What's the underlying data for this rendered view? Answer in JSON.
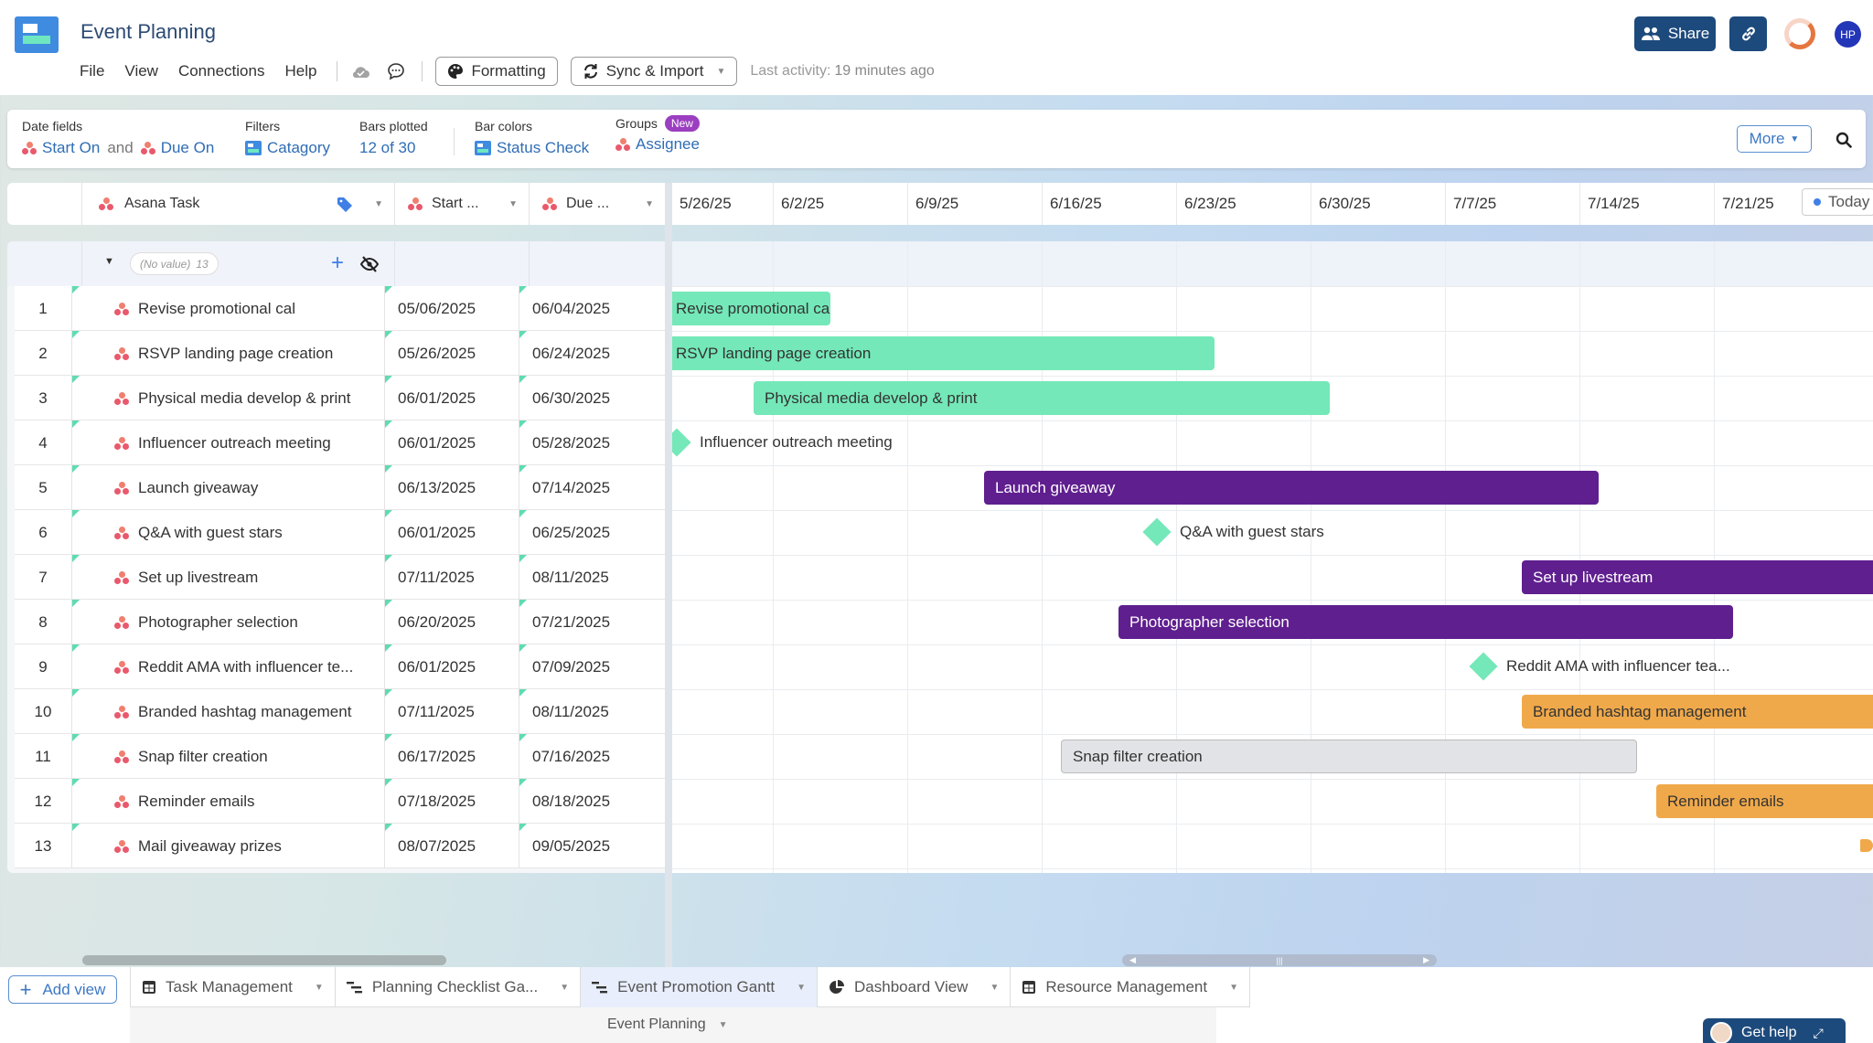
{
  "app": {
    "title": "Event Planning",
    "menu": [
      "File",
      "View",
      "Connections",
      "Help"
    ],
    "formatting_label": "Formatting",
    "sync_label": "Sync & Import",
    "last_activity_label": "Last activity:",
    "last_activity_value": "19 minutes ago",
    "share_label": "Share",
    "avatar_initials": "HP"
  },
  "settings": {
    "date_fields_label": "Date fields",
    "start_field": "Start On",
    "and_text": "and",
    "due_field": "Due On",
    "filters_label": "Filters",
    "filters_value": "Catagory",
    "bars_plotted_label": "Bars plotted",
    "bars_plotted_value": "12 of 30",
    "bar_colors_label": "Bar colors",
    "bar_colors_value": "Status Check",
    "groups_label": "Groups",
    "groups_badge": "New",
    "groups_value": "Assignee",
    "more_label": "More"
  },
  "grid": {
    "columns": {
      "task": "Asana Task",
      "start": "Start ...",
      "due": "Due ..."
    },
    "group": {
      "label": "(No value)",
      "count": "13"
    },
    "rows": [
      {
        "num": "1",
        "task": "Revise promotional cal",
        "start": "05/06/2025",
        "due": "06/04/2025"
      },
      {
        "num": "2",
        "task": "RSVP landing page creation",
        "start": "05/26/2025",
        "due": "06/24/2025"
      },
      {
        "num": "3",
        "task": "Physical media develop & print",
        "start": "06/01/2025",
        "due": "06/30/2025"
      },
      {
        "num": "4",
        "task": "Influencer outreach meeting",
        "start": "06/01/2025",
        "due": "05/28/2025"
      },
      {
        "num": "5",
        "task": "Launch giveaway",
        "start": "06/13/2025",
        "due": "07/14/2025"
      },
      {
        "num": "6",
        "task": "Q&A with guest stars",
        "start": "06/01/2025",
        "due": "06/25/2025"
      },
      {
        "num": "7",
        "task": "Set up livestream",
        "start": "07/11/2025",
        "due": "08/11/2025"
      },
      {
        "num": "8",
        "task": "Photographer selection",
        "start": "06/20/2025",
        "due": "07/21/2025"
      },
      {
        "num": "9",
        "task": "Reddit AMA with influencer te...",
        "start": "06/01/2025",
        "due": "07/09/2025"
      },
      {
        "num": "10",
        "task": "Branded hashtag management",
        "start": "07/11/2025",
        "due": "08/11/2025"
      },
      {
        "num": "11",
        "task": "Snap filter creation",
        "start": "06/17/2025",
        "due": "07/16/2025"
      },
      {
        "num": "12",
        "task": "Reminder emails",
        "start": "07/18/2025",
        "due": "08/18/2025"
      },
      {
        "num": "13",
        "task": "Mail giveaway prizes",
        "start": "08/07/2025",
        "due": "09/05/2025"
      }
    ]
  },
  "timeline": {
    "week_labels": [
      "5/26/25",
      "6/2/25",
      "6/9/25",
      "6/16/25",
      "6/23/25",
      "6/30/25",
      "7/7/25",
      "7/14/25",
      "7/21/25"
    ],
    "today_label": "Today",
    "status_colors": {
      "green": "#74e8b8",
      "purple": "#5f1f8f",
      "orange": "#f0a94a",
      "gray": "#e2e3e6"
    },
    "bars": [
      {
        "label": "Revise promotional cal",
        "start": "2025-05-06",
        "end": "2025-06-04",
        "type": "bar",
        "color": "green"
      },
      {
        "label": "RSVP landing page creation",
        "start": "2025-05-26",
        "end": "2025-06-24",
        "type": "bar",
        "color": "green"
      },
      {
        "label": "Physical media develop & print",
        "start": "2025-06-01",
        "end": "2025-06-30",
        "type": "bar",
        "color": "green"
      },
      {
        "label": "Influencer outreach meeting",
        "start": "2025-05-28",
        "end": "2025-05-28",
        "type": "milestone",
        "color": "green"
      },
      {
        "label": "Launch giveaway",
        "start": "2025-06-13",
        "end": "2025-07-14",
        "type": "bar",
        "color": "purple"
      },
      {
        "label": "Q&A with guest stars",
        "start": "2025-06-22",
        "end": "2025-06-22",
        "type": "milestone",
        "color": "green"
      },
      {
        "label": "Set up livestream",
        "start": "2025-07-11",
        "end": "2025-08-11",
        "type": "bar",
        "color": "purple"
      },
      {
        "label": "Photographer selection",
        "start": "2025-06-20",
        "end": "2025-07-21",
        "type": "bar",
        "color": "purple"
      },
      {
        "label": "Reddit AMA with influencer tea...",
        "start": "2025-07-09",
        "end": "2025-07-09",
        "type": "milestone",
        "color": "green"
      },
      {
        "label": "Branded hashtag management",
        "start": "2025-07-11",
        "end": "2025-08-11",
        "type": "bar",
        "color": "orange"
      },
      {
        "label": "Snap filter creation",
        "start": "2025-06-17",
        "end": "2025-07-16",
        "type": "bar",
        "color": "gray"
      },
      {
        "label": "Reminder emails",
        "start": "2025-07-18",
        "end": "2025-08-18",
        "type": "bar",
        "color": "orange"
      },
      {
        "label": "",
        "start": "2025-08-07",
        "end": "2025-09-05",
        "type": "offscreen",
        "color": "orange"
      }
    ]
  },
  "tabs": {
    "add_view": "Add view",
    "items": [
      {
        "label": "Task Management",
        "icon": "grid-icon"
      },
      {
        "label": "Planning Checklist Ga...",
        "icon": "gantt-icon"
      },
      {
        "label": "Event Promotion Gantt",
        "icon": "gantt-icon",
        "active": true
      },
      {
        "label": "Dashboard View",
        "icon": "pie-chart-icon"
      },
      {
        "label": "Resource Management",
        "icon": "grid-icon"
      }
    ],
    "workbook": "Event Planning"
  },
  "help": {
    "label": "Get help"
  }
}
